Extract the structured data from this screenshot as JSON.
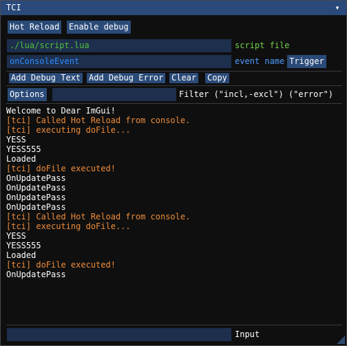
{
  "window": {
    "title": "TCI"
  },
  "toolbar": {
    "hot_reload": "Hot Reload",
    "enable_debug": "Enable debug"
  },
  "script_row": {
    "path_value": "./lua/script.lua",
    "label": "script file"
  },
  "event_row": {
    "event_value": "onConsoleEvent",
    "label": "event name",
    "trigger": "Trigger"
  },
  "actions": {
    "add_debug_text": "Add Debug Text",
    "add_debug_error": "Add Debug Error",
    "clear": "Clear",
    "copy": "Copy"
  },
  "filter_row": {
    "options": "Options",
    "filter_value": "",
    "label": "Filter (\"incl,-excl\") (\"error\")"
  },
  "log": [
    {
      "text": "Welcome to Dear ImGui!",
      "kind": "normal"
    },
    {
      "text": "[tci] Called Hot Reload from console.",
      "kind": "tci"
    },
    {
      "text": "[tci] executing doFile...",
      "kind": "tci"
    },
    {
      "text": "YESS",
      "kind": "normal"
    },
    {
      "text": "YESS555",
      "kind": "normal"
    },
    {
      "text": "Loaded",
      "kind": "normal"
    },
    {
      "text": "[tci] doFile executed!",
      "kind": "tci"
    },
    {
      "text": "OnUpdatePass",
      "kind": "normal"
    },
    {
      "text": "OnUpdatePass",
      "kind": "normal"
    },
    {
      "text": "OnUpdatePass",
      "kind": "normal"
    },
    {
      "text": "OnUpdatePass",
      "kind": "normal"
    },
    {
      "text": "[tci] Called Hot Reload from console.",
      "kind": "tci"
    },
    {
      "text": "[tci] executing doFile...",
      "kind": "tci"
    },
    {
      "text": "YESS",
      "kind": "normal"
    },
    {
      "text": "YESS555",
      "kind": "normal"
    },
    {
      "text": "Loaded",
      "kind": "normal"
    },
    {
      "text": "[tci] doFile executed!",
      "kind": "tci"
    },
    {
      "text": "OnUpdatePass",
      "kind": "normal"
    }
  ],
  "input_row": {
    "input_value": "",
    "label": "Input"
  },
  "colors": {
    "titlebar": "#294a7a",
    "button": "#2a4a78",
    "field": "#1d2f4d",
    "script_value": "#4fc23c",
    "script_label": "#72d04c",
    "event_value": "#2e8cff",
    "event_label": "#4f9dff",
    "tci_log": "#ee8c3a",
    "normal_log": "#ffffff"
  }
}
